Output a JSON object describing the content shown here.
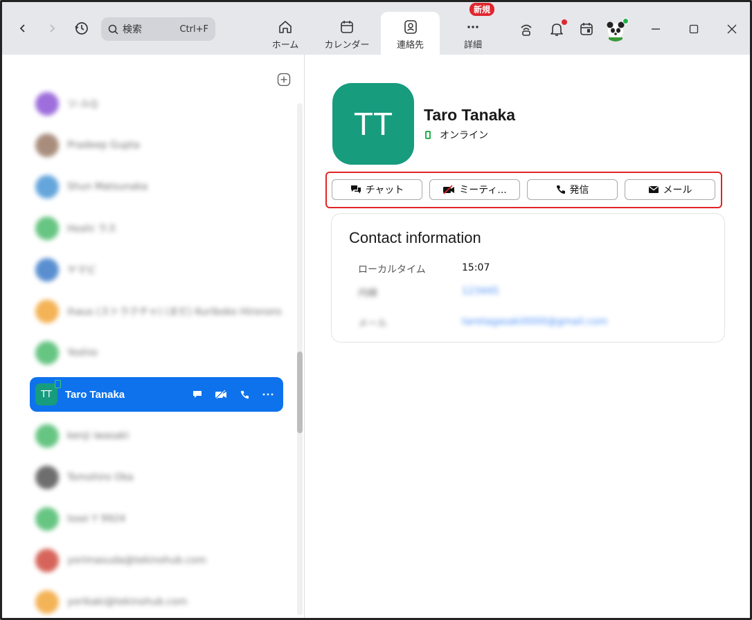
{
  "toolbar": {
    "search_placeholder": "検索",
    "search_shortcut": "Ctrl+F"
  },
  "tabs": [
    {
      "label": "ホーム",
      "icon": "home-icon",
      "active": false
    },
    {
      "label": "カレンダー",
      "icon": "calendar-icon",
      "active": false
    },
    {
      "label": "連絡先",
      "icon": "contacts-icon",
      "active": true
    },
    {
      "label": "詳細",
      "icon": "more-icon",
      "active": false,
      "badge": "新規"
    }
  ],
  "sidebar": {
    "contacts": [
      {
        "name": "ツ-ルQ",
        "color": "#8d55d6"
      },
      {
        "name": "Pradeep Gupta",
        "color": "#9a7a66"
      },
      {
        "name": "Shun Matsunaka",
        "color": "#4a96d6"
      },
      {
        "name": "Hoshi ラス",
        "color": "#4dbb6d"
      },
      {
        "name": "ヤマビ",
        "color": "#3d7cc9"
      },
      {
        "name": "ihaus (ストラクチャ) (まだ) Kuriboko Hironoro",
        "color": "#f2a63a"
      },
      {
        "name": "Yoshio",
        "color": "#4dbb6d"
      },
      {
        "name": "Taro Tanaka",
        "initials": "TT",
        "selected": true
      },
      {
        "name": "kenji iwasaki",
        "color": "#4dbb6d"
      },
      {
        "name": "Tomohiro Oka",
        "color": "#555555"
      },
      {
        "name": "Issei Y 9924",
        "color": "#4dbb6d"
      },
      {
        "name": "yorimasuda@tekinohub.com",
        "color": "#d04a3e"
      },
      {
        "name": "yorikaki@tekinohub.com",
        "color": "#f2a63a"
      }
    ]
  },
  "profile": {
    "initials": "TT",
    "name": "Taro Tanaka",
    "status": "オンライン",
    "actions": {
      "chat": "チャット",
      "meeting": "ミーティ...",
      "call": "発信",
      "mail": "メール"
    }
  },
  "contact_info": {
    "title": "Contact information",
    "local_time_label": "ローカルタイム",
    "local_time_value": "15:07",
    "ext_label": "内線",
    "ext_value": "123445",
    "mail_label": "メール",
    "mail_value": "tarotagasaki0000@gmail.com"
  },
  "colors": {
    "accent": "#0e72ed",
    "avatar": "#179c7e",
    "online": "#22b04b",
    "highlight": "#e02424",
    "badge": "#e0262f"
  }
}
